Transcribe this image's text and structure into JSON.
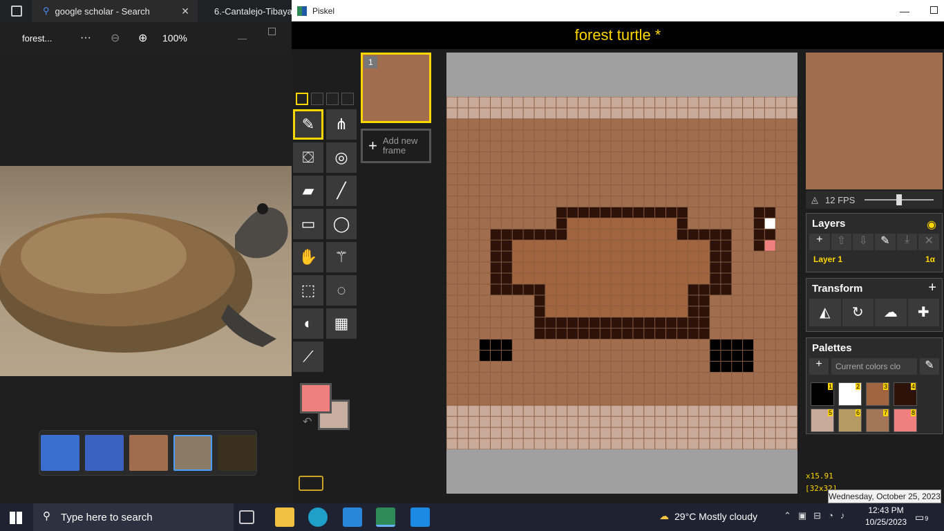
{
  "browser": {
    "tabs": [
      {
        "label": "google scholar - Search"
      },
      {
        "label": "6.-Cantalejo-Tibaya"
      }
    ]
  },
  "photos": {
    "title": "forest...",
    "zoom": "100%"
  },
  "piskel": {
    "window_title": "Piskel",
    "project_title": "forest turtle *",
    "frame_number": "1",
    "add_frame_label": "Add new frame",
    "fps": "12 FPS",
    "layers_title": "Layers",
    "layer_name": "Layer 1",
    "layer_alpha": "1α",
    "transform_title": "Transform",
    "palettes_title": "Palettes",
    "palette_select": "Current colors clo",
    "cursor_pos": "x15.91",
    "size": "[32x32]",
    "primary_color": "#f08080",
    "secondary_color": "#c8ae9e",
    "palette": [
      {
        "n": "1",
        "color": "#000000"
      },
      {
        "n": "2",
        "color": "#ffffff"
      },
      {
        "n": "3",
        "color": "#a0653f"
      },
      {
        "n": "4",
        "color": "#2c1208"
      },
      {
        "n": "5",
        "color": "#c9a999"
      },
      {
        "n": "6",
        "color": "#b59a62"
      },
      {
        "n": "7",
        "color": "#a37657"
      },
      {
        "n": "8",
        "color": "#f08080"
      }
    ]
  },
  "taskbar": {
    "search_placeholder": "Type here to search",
    "weather": "29°C  Mostly cloudy",
    "time": "12:43 PM",
    "date": "10/25/2023",
    "notif_count": "9",
    "tooltip": "Wednesday, October 25, 2023"
  }
}
